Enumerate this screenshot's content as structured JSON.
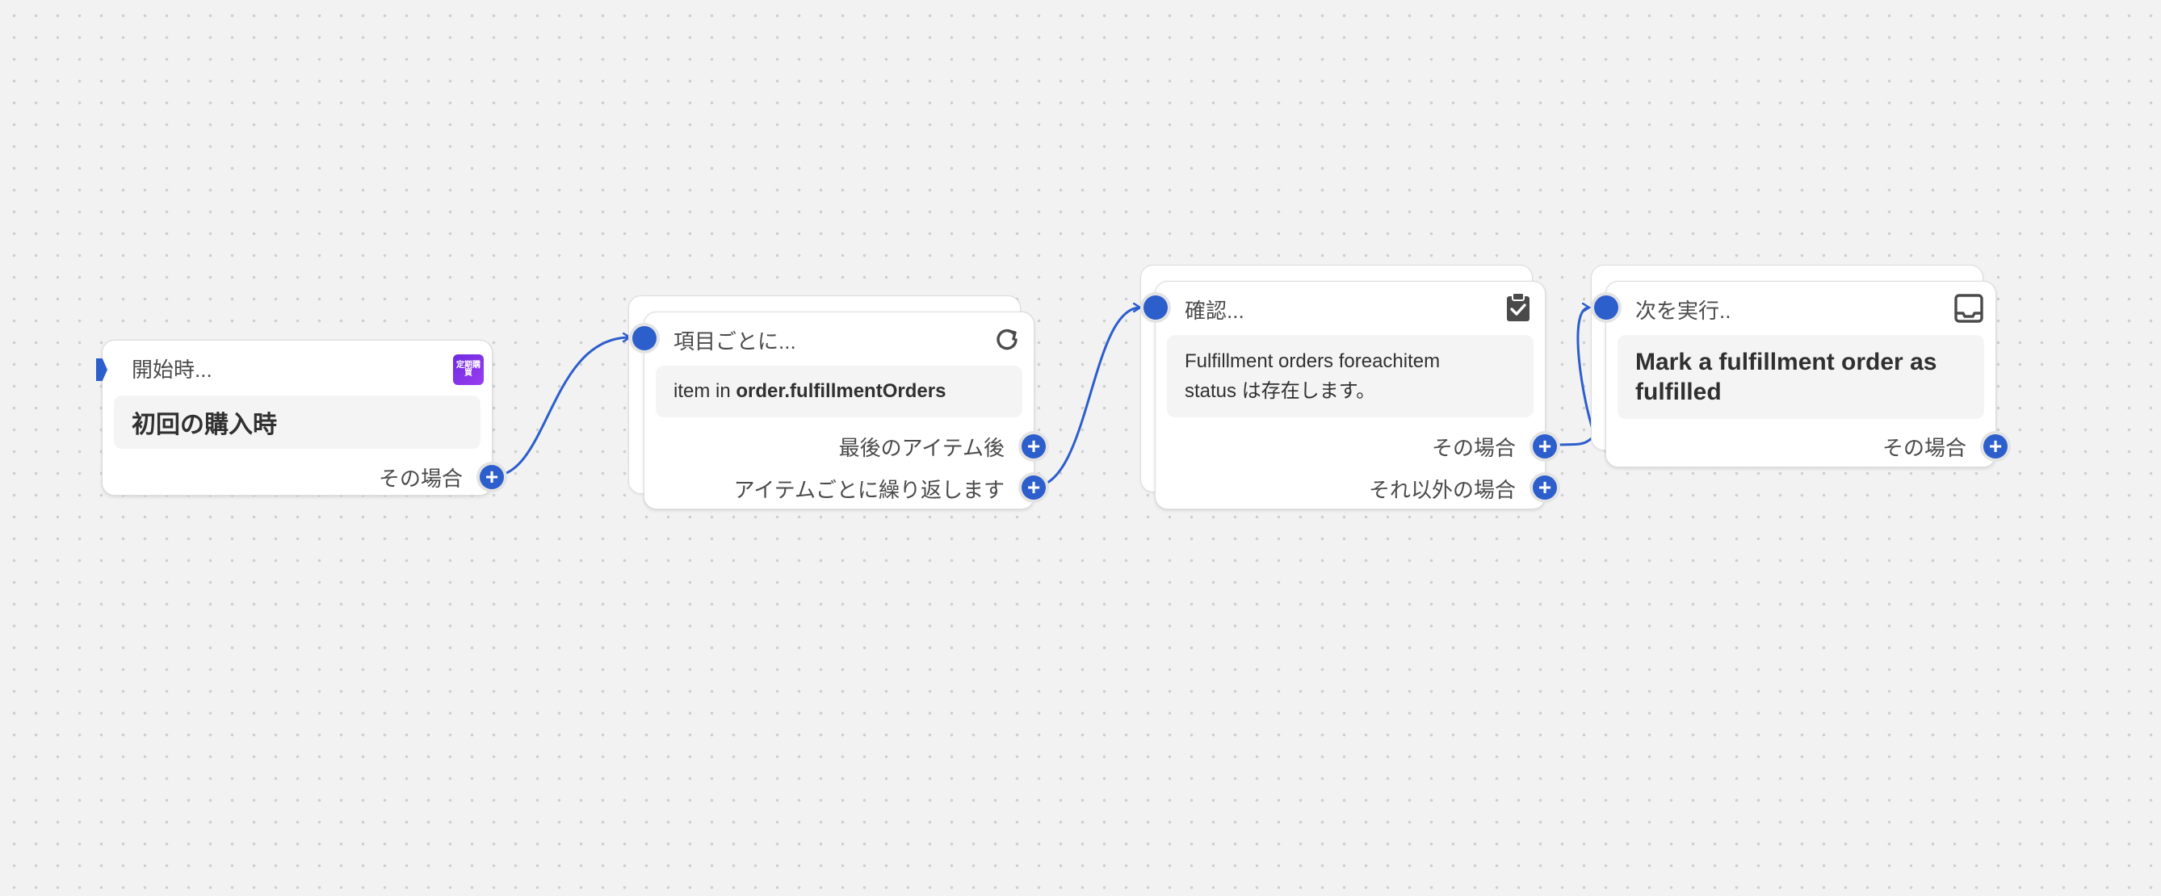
{
  "colors": {
    "accent": "#2c5ecc",
    "canvas": "#f2f2f2",
    "card": "#ffffff",
    "content_bg": "#f4f4f4",
    "app_badge": "#7b2fe8"
  },
  "nodes": {
    "trigger": {
      "title": "開始時...",
      "app_badge": "定期購買",
      "content": "初回の購入時",
      "outputs": {
        "then": "その場合"
      }
    },
    "foreach": {
      "title": "項目ごとに...",
      "icon": "loop-arrow-icon",
      "content_prefix": "item in ",
      "content_bold": "order.fulfillmentOrders",
      "outputs": {
        "after_last": "最後のアイテム後",
        "each": "アイテムごとに繰り返します"
      }
    },
    "condition": {
      "title": "確認...",
      "icon": "clipboard-check-icon",
      "content_line1": "Fulfillment orders foreachitem",
      "content_line2": "status は存在します。",
      "outputs": {
        "then": "その場合",
        "otherwise": "それ以外の場合"
      }
    },
    "action": {
      "title": "次を実行..",
      "icon": "inbox-tray-icon",
      "content_line1": "Mark a fulfillment order as",
      "content_line2": "fulfilled",
      "outputs": {
        "then": "その場合"
      }
    }
  }
}
